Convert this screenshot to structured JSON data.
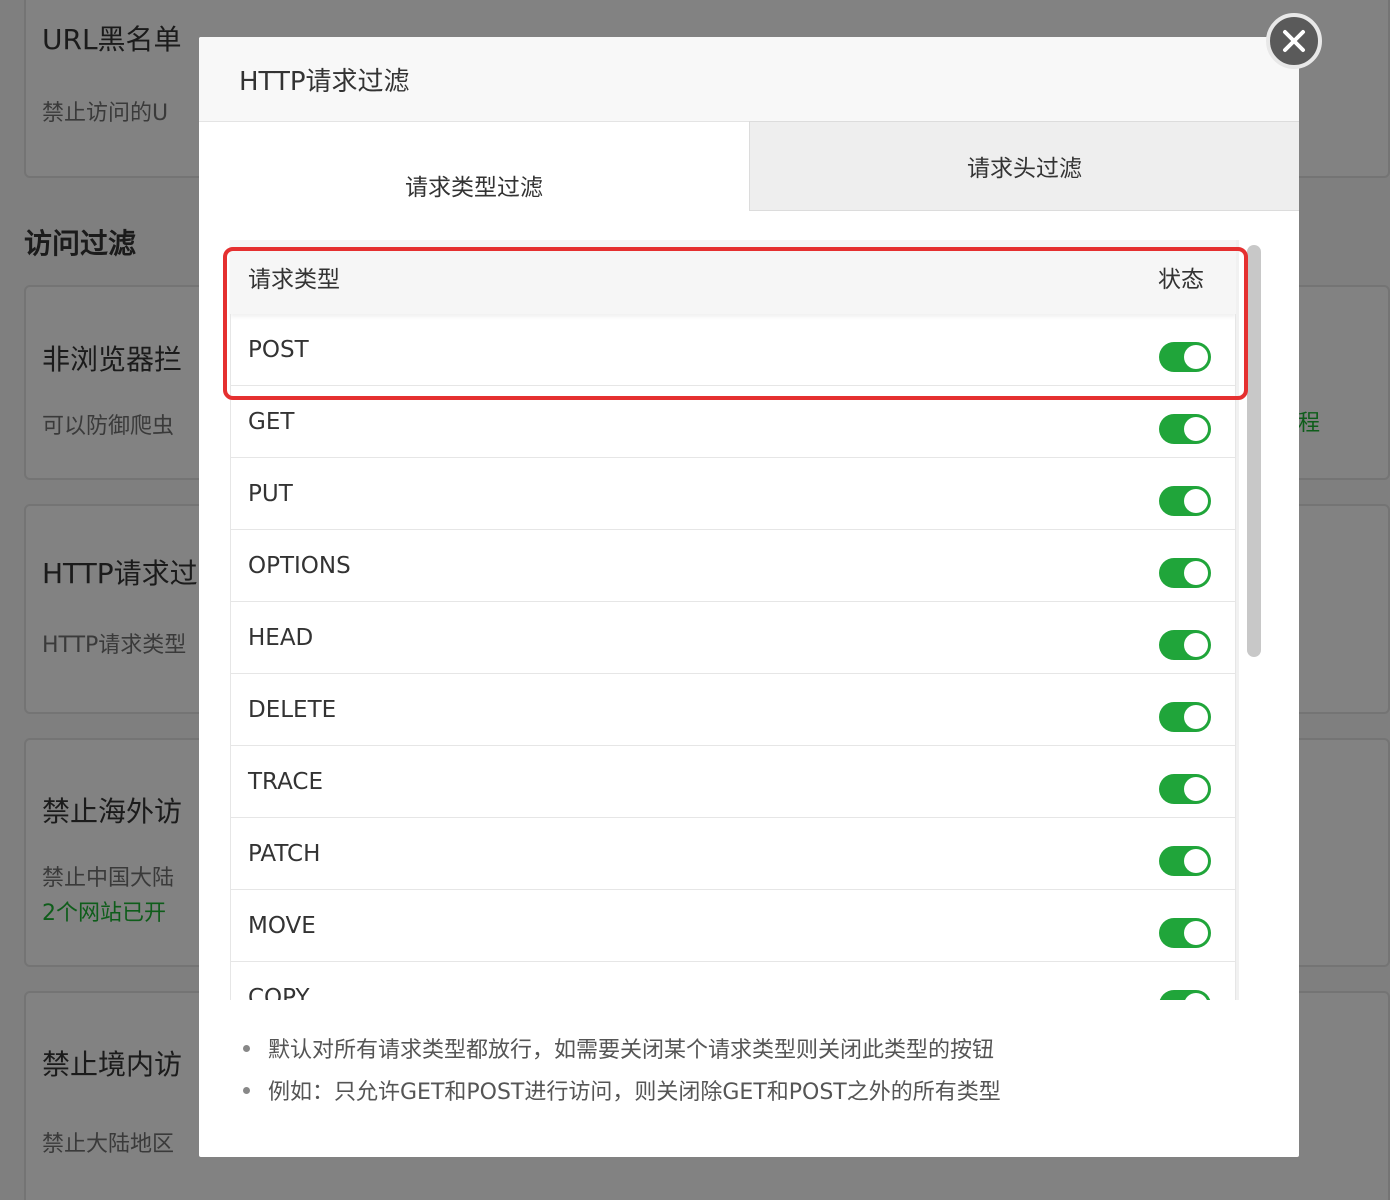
{
  "background": {
    "section_title": "访问过滤",
    "cards": [
      {
        "title": "URL黑名单",
        "desc": "禁止访问的U"
      },
      {
        "title": "非浏览器拦",
        "desc": "可以防御爬虫"
      },
      {
        "title": "HTTP请求过",
        "desc": "HTTP请求类型"
      },
      {
        "title": "禁止海外访",
        "desc": "禁止中国大陆",
        "status": "2个网站已开"
      },
      {
        "title": "禁止境内访",
        "desc": "禁止大陆地区"
      }
    ],
    "right_link": "程"
  },
  "modal": {
    "title": "HTTP请求过滤",
    "tabs": [
      {
        "label": "请求类型过滤",
        "active": true
      },
      {
        "label": "请求头过滤",
        "active": false
      }
    ],
    "table": {
      "columns": [
        "请求类型",
        "状态"
      ],
      "rows": [
        {
          "method": "POST",
          "enabled": true
        },
        {
          "method": "GET",
          "enabled": true
        },
        {
          "method": "PUT",
          "enabled": true
        },
        {
          "method": "OPTIONS",
          "enabled": true
        },
        {
          "method": "HEAD",
          "enabled": true
        },
        {
          "method": "DELETE",
          "enabled": true
        },
        {
          "method": "TRACE",
          "enabled": true
        },
        {
          "method": "PATCH",
          "enabled": true
        },
        {
          "method": "MOVE",
          "enabled": true
        },
        {
          "method": "COPY",
          "enabled": true
        }
      ]
    },
    "notes": [
      "默认对所有请求类型都放行，如需要关闭某个请求类型则关闭此类型的按钮",
      "例如：只允许GET和POST进行访问，则关闭除GET和POST之外的所有类型"
    ],
    "close_icon": "close-icon"
  },
  "colors": {
    "toggle_on": "#20a53a",
    "highlight": "#e53030"
  }
}
